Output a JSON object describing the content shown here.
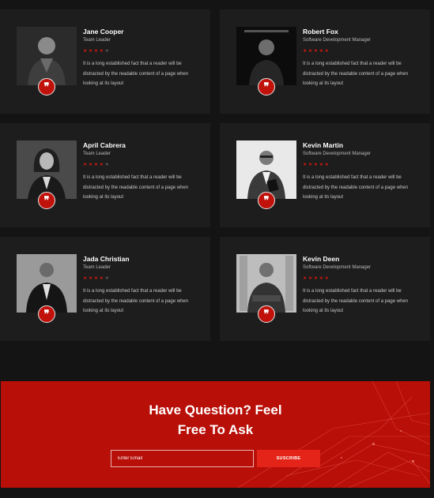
{
  "testimonials": [
    {
      "name": "Jane Cooper",
      "role": "Team Leader",
      "rating": 4,
      "text": "It is a long established fact that a reader will be distracted by the readable content of a page when looking at its layout",
      "photo": "portrait-man-dark-jacket"
    },
    {
      "name": "Robert Fox",
      "role": "Software Development Manager",
      "rating": 5,
      "text": "It is a long established fact that a reader will be distracted by the readable content of a page when looking at its layout",
      "photo": "portrait-man-dark-room"
    },
    {
      "name": "April Cabrera",
      "role": "Team Leader",
      "rating": 4,
      "text": "It is a long established fact that a reader will be distracted by the readable content of a page when looking at its layout",
      "photo": "portrait-woman"
    },
    {
      "name": "Kevin Martin",
      "role": "Software Development Manager",
      "rating": 5,
      "text": "It is a long established fact that a reader will be distracted by the readable content of a page when looking at its layout",
      "photo": "portrait-man-tablet"
    },
    {
      "name": "Jada Christian",
      "role": "Team Leader",
      "rating": 4,
      "text": "It is a long established fact that a reader will be distracted by the readable content of a page when looking at its layout",
      "photo": "portrait-man-suit"
    },
    {
      "name": "Kevin Deen",
      "role": "Software Development Manager",
      "rating": 5,
      "text": "It is a long established fact that a reader will be distracted by the readable content of a page when looking at its layout",
      "photo": "portrait-man-arms-crossed"
    }
  ],
  "quote_icon": "❞",
  "star_glyph": "★",
  "max_rating": 5,
  "cta": {
    "title_line1": "Have Question? Feel",
    "title_line2": "Free To Ask",
    "email_placeholder": "Enter Email",
    "subscribe_label": "SUSCRIBE"
  },
  "colors": {
    "accent": "#c0120b",
    "cta_background": "#b80f08",
    "button": "#e42418",
    "card_background": "#1d1d1d",
    "page_background": "#141414"
  }
}
